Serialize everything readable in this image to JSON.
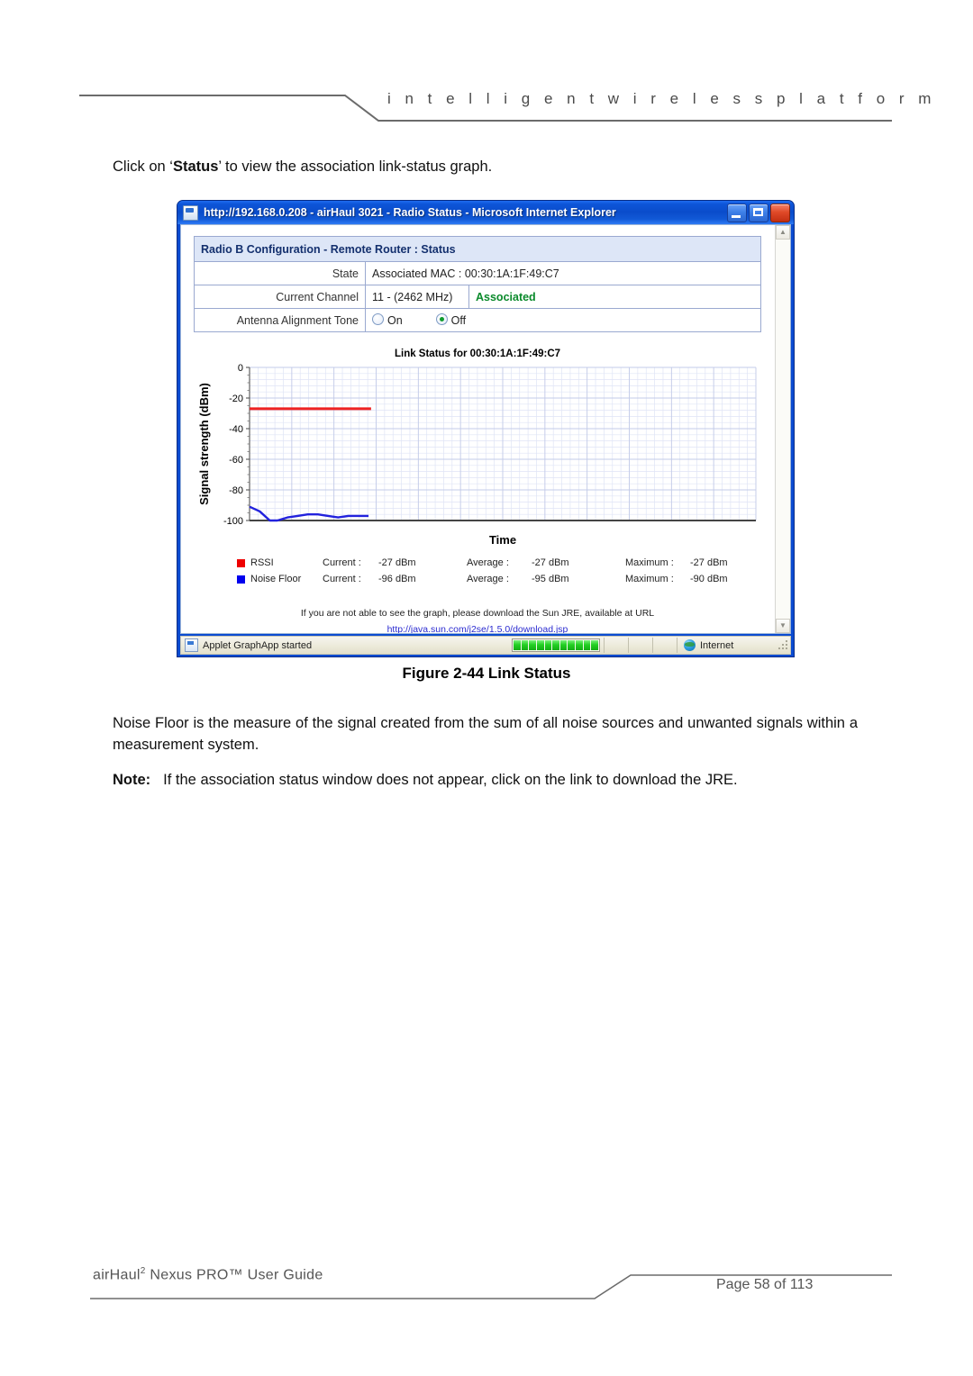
{
  "header": {
    "tagline": "i n t e l l i g e n t     w i r e l e s s     p l a t f o r m"
  },
  "intro": {
    "before": "Click on ‘",
    "bold": "Status",
    "after": "’ to view the association link-status graph."
  },
  "browser": {
    "title": "http://192.168.0.208 - airHaul 3021 - Radio Status - Microsoft Internet Explorer",
    "icons": {
      "page": "page-icon",
      "minimize": "minimize-icon",
      "maximize": "maximize-icon",
      "close": "close-icon"
    },
    "statusbar": {
      "message": "Applet GraphApp started",
      "zone": "Internet",
      "progress_segments": 11
    },
    "scrollbar": {
      "up": "▲",
      "down": "▼"
    }
  },
  "config": {
    "heading": "Radio B Configuration - Remote Router : Status",
    "rows": [
      {
        "label": "State",
        "value": "Associated MAC : 00:30:1A:1F:49:C7",
        "extra": ""
      },
      {
        "label": "Current Channel",
        "value": "11 - (2462 MHz)",
        "extra": "Associated"
      },
      {
        "label": "Antenna Alignment Tone",
        "value": "",
        "extra": ""
      }
    ],
    "tone": {
      "on_label": "On",
      "off_label": "Off",
      "selected": "Off"
    }
  },
  "chart_data": {
    "type": "line",
    "title": "Link Status for 00:30:1A:1F:49:C7",
    "xlabel": "Time",
    "ylabel": "Signal strength (dBm)",
    "ylim": [
      -100,
      0
    ],
    "yticks": [
      0,
      -20,
      -40,
      -60,
      -80,
      -100
    ],
    "ytick_labels": [
      "0",
      "-20",
      "-40",
      "-60",
      "-80",
      "-100"
    ],
    "grid": true,
    "x_fraction_covered": 0.24,
    "series": [
      {
        "name": "RSSI",
        "color": "#ee2222",
        "x": [
          0,
          0.03,
          0.06,
          0.09,
          0.12,
          0.15,
          0.18,
          0.21,
          0.24
        ],
        "values": [
          -27,
          -27,
          -27,
          -27,
          -27,
          -27,
          -27,
          -27,
          -27
        ]
      },
      {
        "name": "Noise Floor",
        "color": "#2222dd",
        "x": [
          0,
          0.02,
          0.04,
          0.055,
          0.075,
          0.095,
          0.115,
          0.135,
          0.155,
          0.175,
          0.195,
          0.215,
          0.235
        ],
        "values": [
          -91,
          -94,
          -100,
          -100,
          -98,
          -97,
          -96,
          -96,
          -97,
          -98,
          -97,
          -97,
          -97
        ]
      }
    ]
  },
  "legend": {
    "columns": [
      "Current :",
      "Average :",
      "Maximum :"
    ],
    "rows": [
      {
        "name": "RSSI",
        "color": "#ee0000",
        "current": "-27 dBm",
        "average": "-27 dBm",
        "maximum": "-27 dBm"
      },
      {
        "name": "Noise Floor",
        "color": "#0000ee",
        "current": "-96 dBm",
        "average": "-95 dBm",
        "maximum": "-90 dBm"
      }
    ]
  },
  "jre": {
    "text": "If you are not able to see the graph, please download the Sun JRE, available at URL",
    "link": "http://java.sun.com/j2se/1.5.0/download.jsp"
  },
  "caption": "Figure 2-44 Link Status",
  "paragraphs": {
    "noise": "Noise Floor is the measure of the signal created from the sum of all noise sources and unwanted signals within a measurement system."
  },
  "note": {
    "label": "Note:",
    "body": "If the association status window does not appear, click on the link to download the JRE."
  },
  "footer": {
    "left_a": "airHaul",
    "left_sup": "2",
    "left_b": " Nexus PRO™ User Guide",
    "right": "Page 58 of 113"
  }
}
